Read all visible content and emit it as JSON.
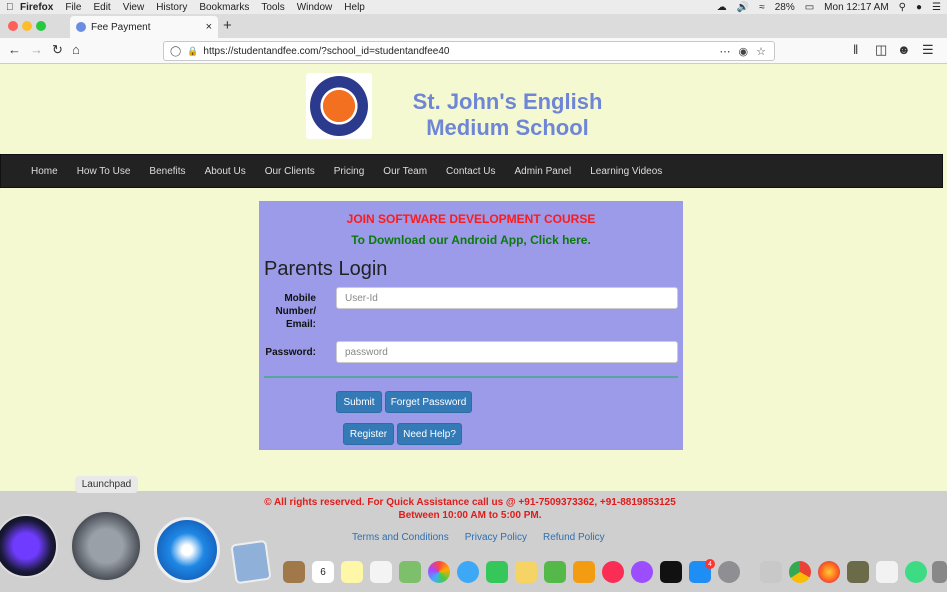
{
  "menubar": {
    "app": "Firefox",
    "items": [
      "File",
      "Edit",
      "View",
      "History",
      "Bookmarks",
      "Tools",
      "Window",
      "Help"
    ],
    "battery": "28%",
    "clock": "Mon 12:17 AM"
  },
  "browser": {
    "tab_title": "Fee Payment",
    "tab_close": "×",
    "new_tab": "+",
    "url": "https://studentandfee.com/?school_id=studentandfee40"
  },
  "header": {
    "school_name": "St. John's English Medium School"
  },
  "nav": {
    "items": [
      "Home",
      "How To Use",
      "Benefits",
      "About Us",
      "Our Clients",
      "Pricing",
      "Our Team",
      "Contact Us",
      "Admin Panel",
      "Learning Videos"
    ]
  },
  "login": {
    "promo_course": "JOIN SOFTWARE DEVELOPMENT COURSE",
    "promo_app": "To Download our Android App, Click here.",
    "title": "Parents Login",
    "user_label_1": "Mobile",
    "user_label_2": "Number/",
    "user_label_3": "Email:",
    "user_placeholder": "User-Id",
    "password_label": "Password:",
    "password_placeholder": "password",
    "submit": "Submit",
    "forget": "Forget Password",
    "register": "Register",
    "help": "Need Help?"
  },
  "footer": {
    "copyright_1": "© All rights reserved. For Quick Assistance call us @ +91-7509373362, +91-8819853125",
    "copyright_2": "Between 10:00 AM to 5:00 PM.",
    "links": [
      "Terms and Conditions",
      "Privacy Policy",
      "Refund Policy"
    ]
  },
  "dock": {
    "tooltip": "Launchpad",
    "calendar_day": "6",
    "appstore_badge": "4"
  },
  "colors": {
    "page_bg": "#f5f9d2",
    "school_name": "#6f86d6",
    "nav_bg": "#222222",
    "panel_bg": "#9b9bea",
    "promo_red": "#ff1a1a",
    "promo_green": "#0b7a0b",
    "button": "#337ab7"
  }
}
